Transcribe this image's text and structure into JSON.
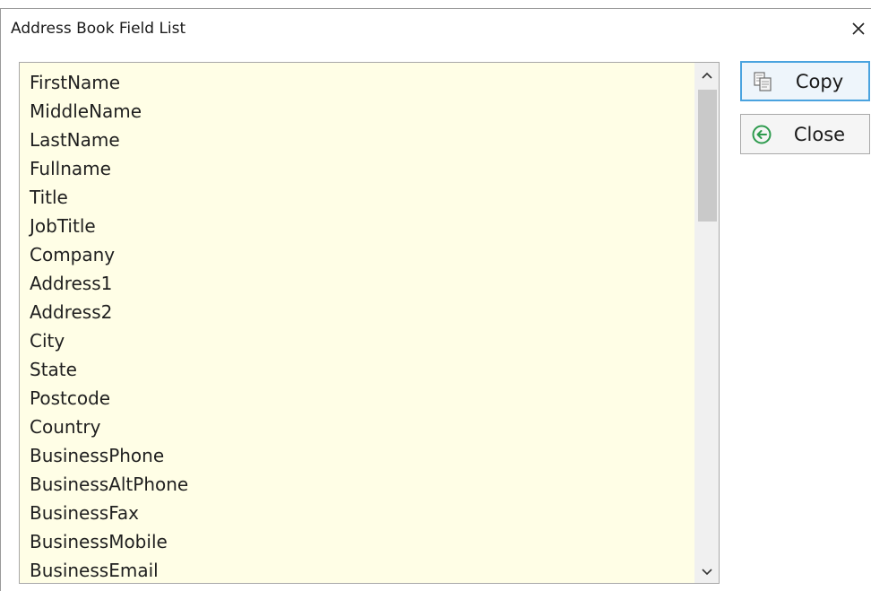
{
  "window": {
    "title": "Address Book Field List"
  },
  "fields": [
    "FirstName",
    "MiddleName",
    "LastName",
    "Fullname",
    "Title",
    "JobTitle",
    "Company",
    "Address1",
    "Address2",
    "City",
    "State",
    "Postcode",
    "Country",
    "BusinessPhone",
    "BusinessAltPhone",
    "BusinessFax",
    "BusinessMobile",
    "BusinessEmail"
  ],
  "buttons": {
    "copy_label": "Copy",
    "copy_icon": "copy-icon",
    "close_label": "Close",
    "close_icon": "back-arrow-circle-icon"
  },
  "colors": {
    "list_background": "#fffee6",
    "copy_focus_border": "#4aa3df",
    "close_icon": "#2e9b4e"
  }
}
